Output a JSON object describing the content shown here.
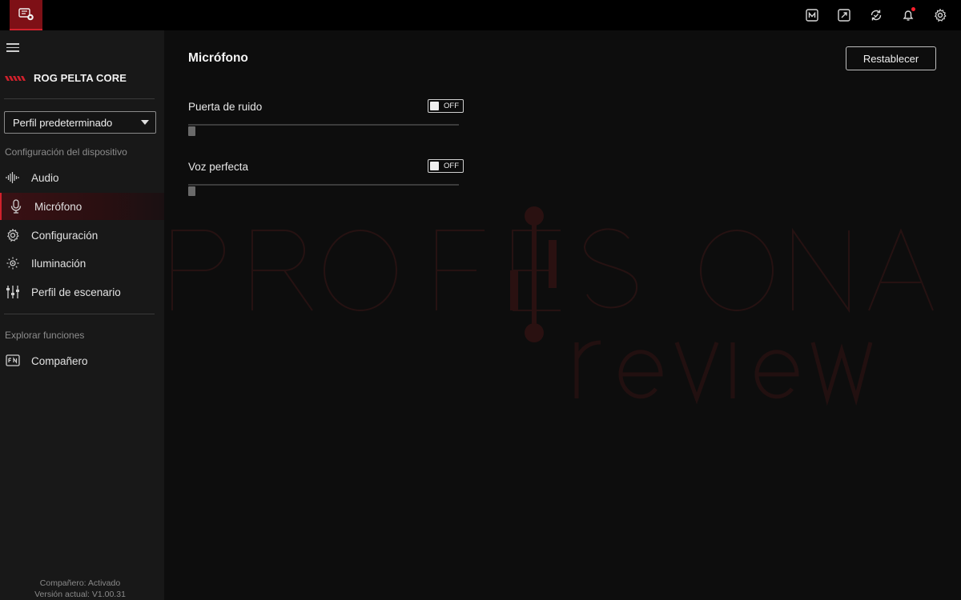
{
  "topbar": {
    "app_icon": "rog-device-icon",
    "icons": [
      "macro-icon",
      "resize-icon",
      "sync-icon",
      "bell-icon",
      "gear-icon"
    ],
    "notification_dot_color": "#ff1f2d"
  },
  "sidebar": {
    "brand_name": "ROG PELTA CORE",
    "profile_select": "Perfil predeterminado",
    "section_device": "Configuración del dispositivo",
    "items": [
      {
        "label": "Audio",
        "icon": "audio-wave-icon"
      },
      {
        "label": "Micrófono",
        "icon": "microphone-icon",
        "active": true
      },
      {
        "label": "Configuración",
        "icon": "gear-icon"
      },
      {
        "label": "Iluminación",
        "icon": "lighting-icon"
      },
      {
        "label": "Perfil de escenario",
        "icon": "equalizer-icon"
      }
    ],
    "section_explore": "Explorar funciones",
    "explore_items": [
      {
        "label": "Compañero",
        "icon": "companion-icon"
      }
    ],
    "footer_status": "Compañero: Activado",
    "footer_version": "Versión actual: V1.00.31"
  },
  "main": {
    "title": "Micrófono",
    "reset_label": "Restablecer",
    "settings": [
      {
        "label": "Puerta de ruido",
        "toggle": "OFF",
        "slider_level": 0
      },
      {
        "label": "Voz perfecta",
        "toggle": "OFF",
        "slider_level": 0
      }
    ]
  },
  "colors": {
    "accent": "#d0212c",
    "app_tab": "#7e1016",
    "sidebar_bg": "#181818",
    "main_bg": "#0d0d0d"
  }
}
